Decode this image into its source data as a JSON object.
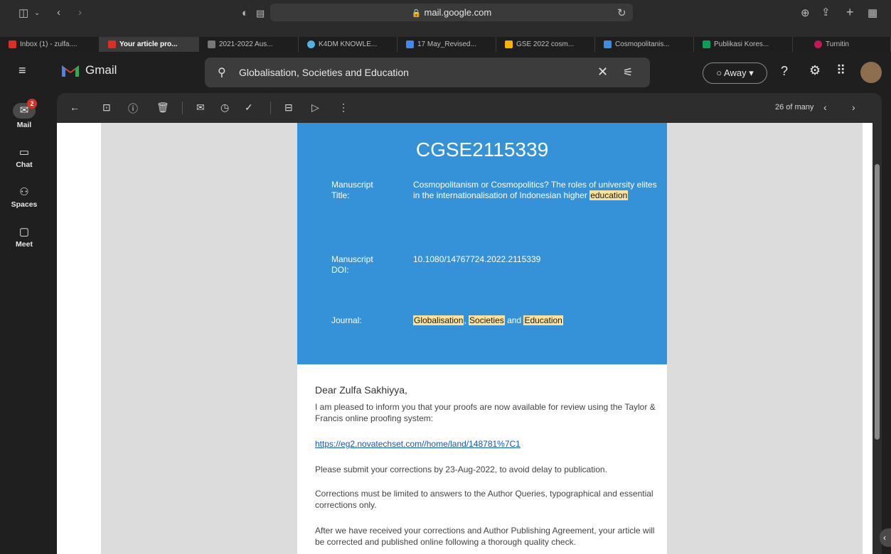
{
  "browser": {
    "url": "mail.google.com",
    "tabs": [
      {
        "label": "Inbox (1) - zulfa....",
        "color": "#d93025",
        "active": false
      },
      {
        "label": "Your article pro...",
        "color": "#d93025",
        "active": true
      },
      {
        "label": "2021-2022 Aus...",
        "color": "#777777",
        "active": false
      },
      {
        "label": "K4DM KNOWLE...",
        "color": "#4fb3e8",
        "active": false
      },
      {
        "label": "17 May_Revised...",
        "color": "#4285f4",
        "active": false
      },
      {
        "label": "GSE 2022 cosm...",
        "color": "#f4b400",
        "active": false
      },
      {
        "label": "Cosmopolitanis...",
        "color": "#3a8ee6",
        "active": false
      },
      {
        "label": "Publikasi Kores...",
        "color": "#0f9d58",
        "active": false
      },
      {
        "label": "Turnitin",
        "color": "#c2185b",
        "active": false
      }
    ]
  },
  "gmail": {
    "logo_text": "Gmail",
    "search_value": "Globalisation, Societies and Education",
    "status": "Away",
    "rail": [
      {
        "label": "Mail",
        "badge": "2"
      },
      {
        "label": "Chat"
      },
      {
        "label": "Spaces"
      },
      {
        "label": "Meet"
      }
    ],
    "pager": "26 of many"
  },
  "email": {
    "code": "CGSE2115339",
    "title_label": "Manuscript Title:",
    "title_value_plain": "Cosmopolitanism or Cosmopolitics? The roles of university elites in the internationalisation of Indonesian higher",
    "title_value_hl": "education",
    "doi_label": "Manuscript DOI:",
    "doi_value": "10.1080/14767724.2022.2115339",
    "journal_label": "Journal:",
    "journal_parts": [
      "Globalisation",
      ", ",
      "Societies",
      " and ",
      "Education"
    ],
    "greeting": "Dear Zulfa Sakhiyya,",
    "p1": "I am pleased to inform you that your proofs are now available for review using the Taylor & Francis online proofing system:",
    "link": "https://eg2.novatechset.com//home/land/148781%7C1",
    "p2": "Please submit your corrections by 23-Aug-2022, to avoid delay to publication.",
    "p3": "Corrections must be limited to answers to the Author Queries, typographical and essential corrections only.",
    "p4": "After we have received your corrections and Author Publishing Agreement, your article will be corrected and published online following a thorough quality check."
  }
}
